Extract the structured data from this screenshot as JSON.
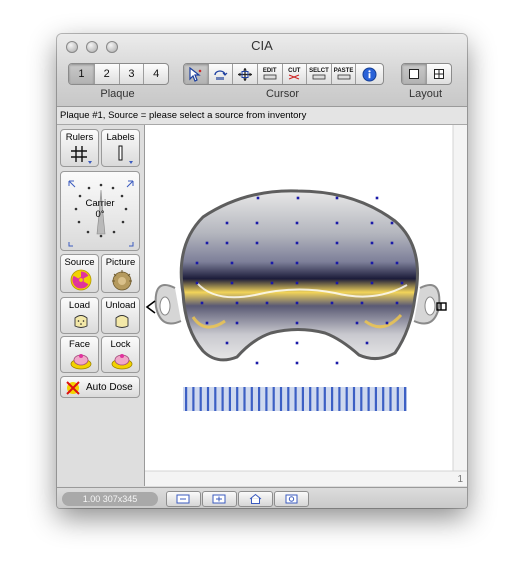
{
  "window": {
    "title": "CIA"
  },
  "toolbar": {
    "plaque_tabs": [
      "1",
      "2",
      "3",
      "4"
    ],
    "plaque_label": "Plaque",
    "cursor_label": "Cursor",
    "cursor_tools": [
      {
        "icon": "pointer-icon"
      },
      {
        "icon": "rotate-icon"
      },
      {
        "icon": "move-icon"
      },
      {
        "text": "EDIT"
      },
      {
        "text": "CUT"
      },
      {
        "text": "SELCT"
      },
      {
        "text": "PASTE"
      },
      {
        "icon": "info-icon"
      }
    ],
    "layout_label": "Layout"
  },
  "status": {
    "text": "Plaque #1, Source = please select a source from inventory"
  },
  "sidebar": {
    "rulers_label": "Rulers",
    "labels_label": "Labels",
    "carrier_label": "Carrier",
    "carrier_angle": "0°",
    "source_label": "Source",
    "picture_label": "Picture",
    "load_label": "Load",
    "unload_label": "Unload",
    "face_label": "Face",
    "lock_label": "Lock",
    "auto_dose_label": "Auto Dose"
  },
  "canvas": {
    "page_number": "1"
  },
  "bottom": {
    "zoom_info": "1.00 307x345"
  },
  "colors": {
    "seed_dot": "#1a1aa8",
    "ruler_stripe": "#3c5fc4",
    "radiation_pink": "#e0339e",
    "warning_yellow": "#f2d200"
  }
}
